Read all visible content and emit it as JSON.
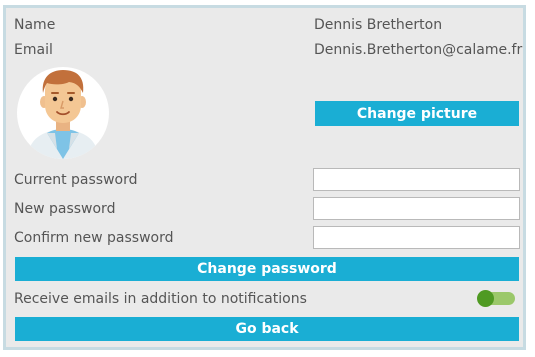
{
  "profile": {
    "name_label": "Name",
    "name_value": "Dennis Bretherton",
    "email_label": "Email",
    "email_value": "Dennis.Bretherton@calame.fr"
  },
  "picture": {
    "change_picture_label": "Change picture"
  },
  "password": {
    "current_label": "Current password",
    "current_value": "",
    "new_label": "New password",
    "new_value": "",
    "confirm_label": "Confirm new password",
    "confirm_value": "",
    "change_password_label": "Change password"
  },
  "notifications": {
    "receive_emails_label": "Receive emails in addition to notifications",
    "receive_emails_enabled": true
  },
  "footer": {
    "go_back_label": "Go back"
  },
  "colors": {
    "accent": "#1aaed4",
    "panel_bg": "#eaeaea",
    "toggle_on": "#4f9a22"
  }
}
